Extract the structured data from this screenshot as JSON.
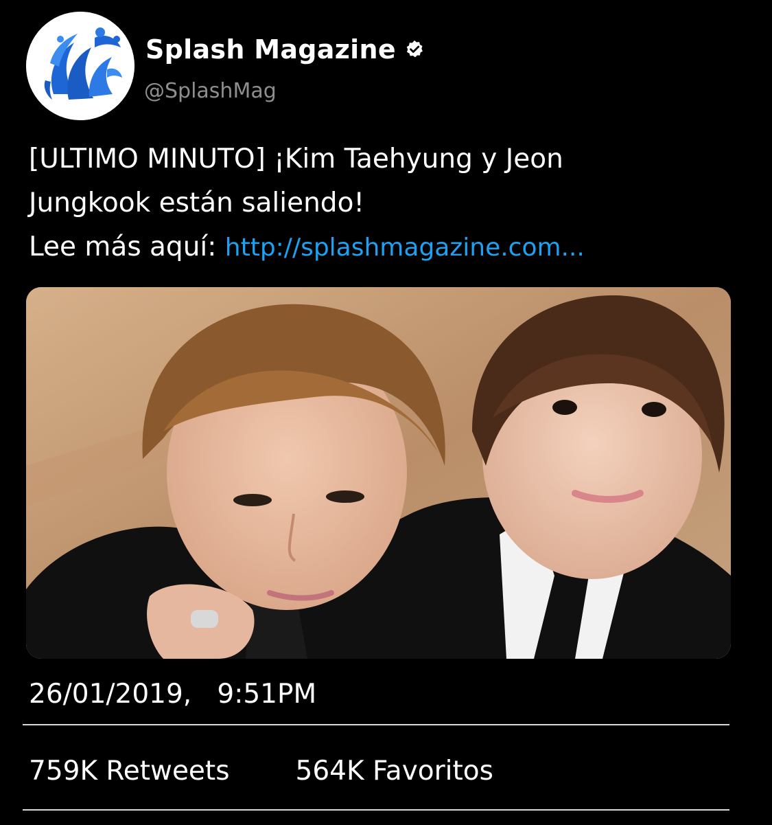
{
  "author": {
    "display_name": "Splash Magazine",
    "handle": "@SplashMag",
    "verified": true,
    "avatar_icon": "splash-logo-icon",
    "avatar_color": "#1e66d6"
  },
  "tweet": {
    "text_line1": "[ULTIMO MINUTO] ¡Kim Taehyung y Jeon",
    "text_line2": "Jungkook están saliendo!",
    "text_line3_prefix": "Lee más aquí: ",
    "link": "http://splashmagazine.com...",
    "link_color": "#1da1f2",
    "media_icon": "photo-two-people-icon"
  },
  "meta": {
    "date": "26/01/2019,",
    "time": "9:51PM"
  },
  "stats": {
    "retweets": "759K Retweets",
    "favorites": "564K Favoritos"
  }
}
